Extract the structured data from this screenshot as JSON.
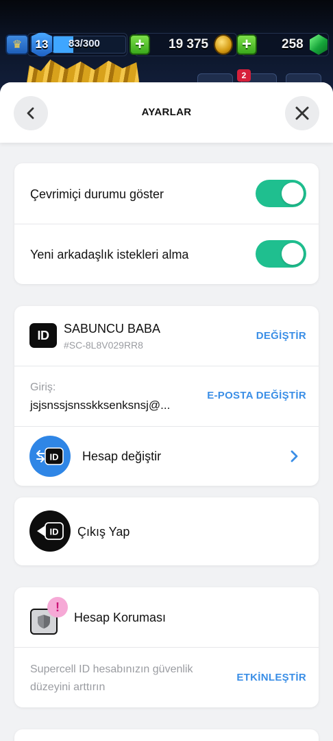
{
  "hud": {
    "level": "13",
    "xp_text": "83/300",
    "xp_progress": 0.28,
    "gold": "19 375",
    "gems": "258",
    "notification_count": "2"
  },
  "header": {
    "title": "AYARLAR",
    "back_icon": "chevron-left-icon",
    "close_icon": "close-icon"
  },
  "social_settings": {
    "online_status_label": "Çevrimiçi durumu göster",
    "online_status_on": true,
    "friend_requests_label": "Yeni arkadaşlık istekleri alma",
    "friend_requests_on": true
  },
  "account": {
    "id_badge": "ID",
    "player_name": "SABUNCU BABA",
    "player_tag": "#SC-8L8V029RR8",
    "change_label": "DEĞİŞTİR",
    "login_label": "Giriş:",
    "login_email": "jsjsnssjsnsskksenksnsj@...",
    "change_email_label": "E-POSTA DEĞİŞTİR",
    "switch_account_label": "Hesap değiştir"
  },
  "logout": {
    "label": "Çıkış Yap"
  },
  "protection": {
    "title": "Hesap Koruması",
    "warning_mark": "!",
    "description": "Supercell ID hesabınızın güvenlik düzeyini arttırın",
    "enable_label": "ETKİNLEŞTİR"
  },
  "colors": {
    "toggle_on": "#1fbf8f",
    "link_blue": "#3a8ee6",
    "switch_icon_bg": "#2f86e6",
    "warning_pink": "#f6a9d6"
  }
}
